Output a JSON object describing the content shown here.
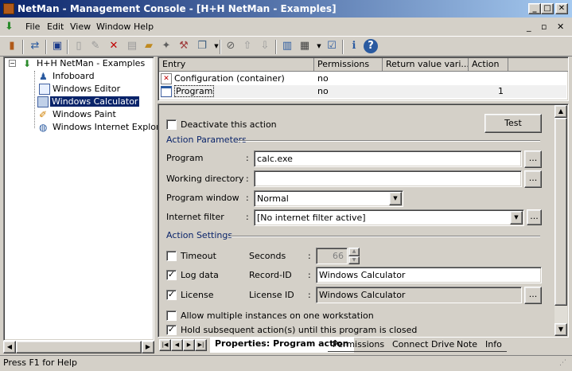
{
  "window": {
    "title": "NetMan - Management Console - [H+H NetMan - Examples]",
    "minimize": "_",
    "maximize": "□",
    "close": "✕",
    "inner_min": "_",
    "inner_restore": "▫",
    "inner_close": "✕"
  },
  "menu": [
    {
      "label": "File"
    },
    {
      "label": "Edit"
    },
    {
      "label": "View"
    },
    {
      "label": "Window"
    },
    {
      "label": "Help"
    }
  ],
  "tree": {
    "root": "H+H NetMan - Examples",
    "expander": "−",
    "items": [
      "Infoboard",
      "Windows Editor",
      "Windows Calculator",
      "Windows Paint",
      "Windows Internet Explorer"
    ],
    "selected": "Windows Calculator"
  },
  "grid": {
    "columns": [
      "Entry",
      "Permissions",
      "Return value vari...",
      "Action"
    ],
    "rows": [
      {
        "entry": "Configuration (container)",
        "permissions": "no",
        "return": "",
        "action": ""
      },
      {
        "entry": "Program",
        "permissions": "no",
        "return": "",
        "action": "1"
      }
    ]
  },
  "form": {
    "deactivate_label": "Deactivate this action",
    "test_label": "Test",
    "action_parameters": "Action Parameters",
    "program_label": "Program",
    "program_value": "calc.exe",
    "workdir_label": "Working directory",
    "workdir_value": "",
    "window_label": "Program window",
    "window_value": "Normal",
    "filter_label": "Internet filter",
    "filter_value": "[No internet filter active]",
    "colon": ":",
    "browse": "...",
    "action_settings": "Action Settings",
    "timeout_label": "Timeout",
    "seconds_label": "Seconds",
    "seconds_value": "66",
    "logdata_label": "Log data",
    "recordid_label": "Record-ID",
    "recordid_value": "Windows Calculator",
    "license_label": "License",
    "licenseid_label": "License ID",
    "licenseid_value": "Windows Calculator",
    "multi_label": "Allow multiple instances on one workstation",
    "hold_label": "Hold subsequent action(s) until this program is closed",
    "check": "✓"
  },
  "checkboxes": {
    "deactivate": false,
    "timeout": false,
    "logdata": true,
    "license": true,
    "multi": false,
    "hold": true
  },
  "tabs": [
    "Properties: Program action",
    "Permissions",
    "Connect Drive",
    "Note",
    "Info"
  ],
  "status": "Press F1 for Help",
  "colors": {
    "title_start": "#0a246a",
    "title_end": "#a6caf0",
    "selection": "#0a246a",
    "section_text": "#0a246a"
  }
}
